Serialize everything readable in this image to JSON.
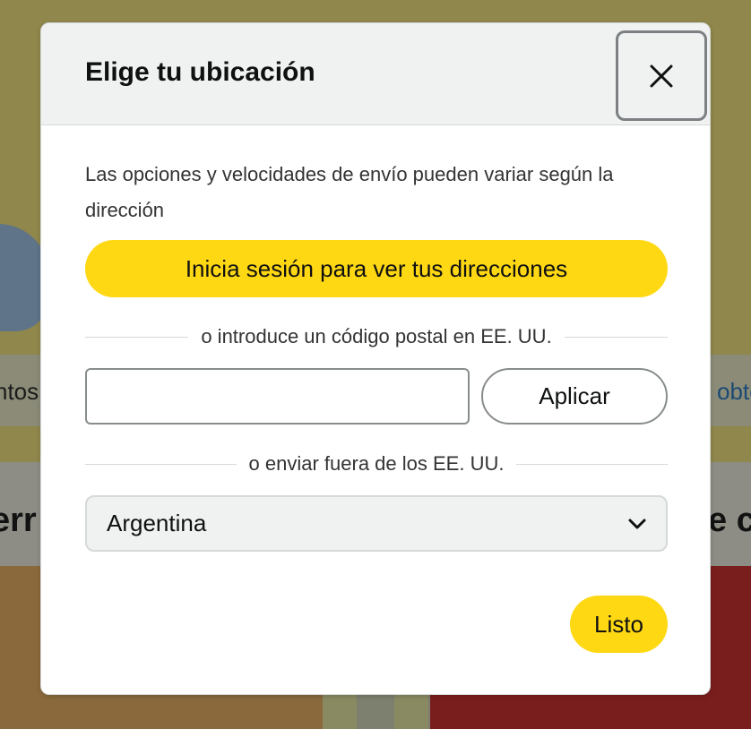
{
  "background": {
    "strip_left_text": "ntos",
    "strip_right_text": "obte",
    "heading_left_text": "err",
    "heading_right_text": "e c"
  },
  "modal": {
    "title": "Elige tu ubicación",
    "close_icon": "close-icon",
    "shipping_note": "Las opciones y velocidades de envío pueden variar según la dirección",
    "signin_button_label": "Inicia sesión para ver tus direcciones",
    "zip_divider_text": "o introduce un código postal en EE. UU.",
    "zip_input_value": "",
    "apply_button_label": "Aplicar",
    "country_divider_text": "o enviar fuera de los EE. UU.",
    "country_selected": "Argentina",
    "chevron_icon": "chevron-down-icon",
    "done_button_label": "Listo"
  },
  "colors": {
    "accent_yellow": "#ffd814",
    "header_bg": "#f0f2f2",
    "text_primary": "#0f1111"
  }
}
